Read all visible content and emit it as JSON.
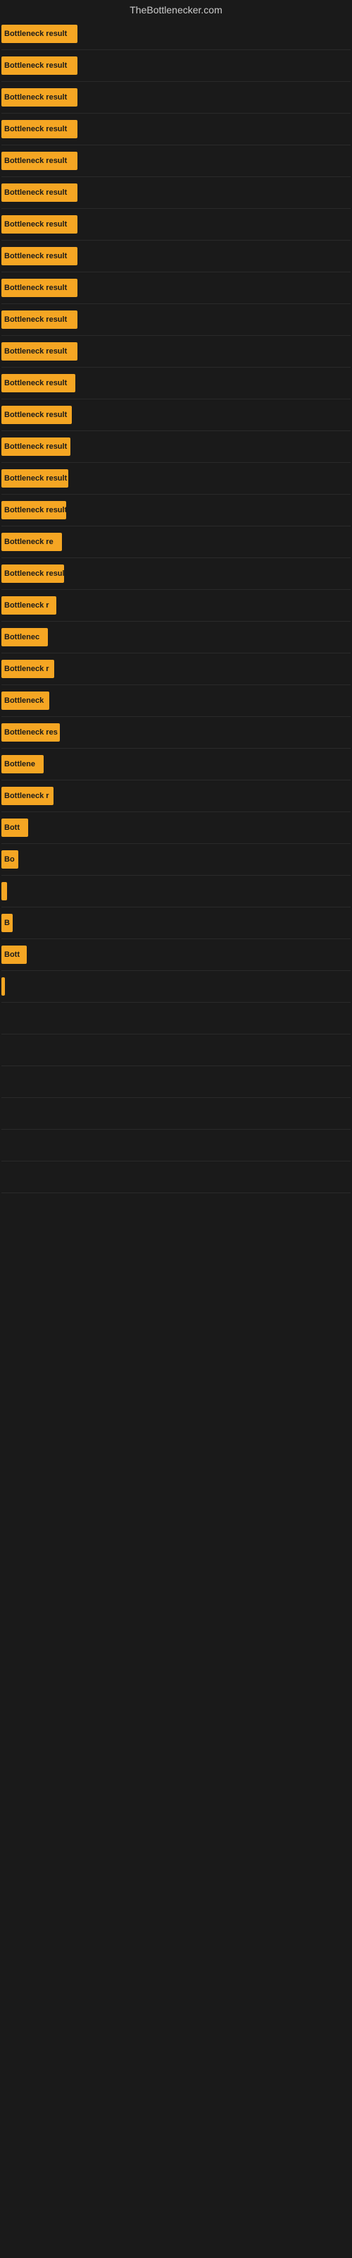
{
  "site": {
    "title": "TheBottlenecker.com"
  },
  "bars": [
    {
      "label": "Bottleneck result",
      "width": 108
    },
    {
      "label": "Bottleneck result",
      "width": 108
    },
    {
      "label": "Bottleneck result",
      "width": 108
    },
    {
      "label": "Bottleneck result",
      "width": 108
    },
    {
      "label": "Bottleneck result",
      "width": 108
    },
    {
      "label": "Bottleneck result",
      "width": 108
    },
    {
      "label": "Bottleneck result",
      "width": 108
    },
    {
      "label": "Bottleneck result",
      "width": 108
    },
    {
      "label": "Bottleneck result",
      "width": 108
    },
    {
      "label": "Bottleneck result",
      "width": 108
    },
    {
      "label": "Bottleneck result",
      "width": 108
    },
    {
      "label": "Bottleneck result",
      "width": 105
    },
    {
      "label": "Bottleneck result",
      "width": 100
    },
    {
      "label": "Bottleneck result",
      "width": 98
    },
    {
      "label": "Bottleneck result",
      "width": 95
    },
    {
      "label": "Bottleneck result",
      "width": 92
    },
    {
      "label": "Bottleneck re",
      "width": 86
    },
    {
      "label": "Bottleneck result",
      "width": 89
    },
    {
      "label": "Bottleneck r",
      "width": 78
    },
    {
      "label": "Bottlenec",
      "width": 66
    },
    {
      "label": "Bottleneck r",
      "width": 75
    },
    {
      "label": "Bottleneck",
      "width": 68
    },
    {
      "label": "Bottleneck res",
      "width": 83
    },
    {
      "label": "Bottlene",
      "width": 60
    },
    {
      "label": "Bottleneck r",
      "width": 74
    },
    {
      "label": "Bott",
      "width": 38
    },
    {
      "label": "Bo",
      "width": 24
    },
    {
      "label": "",
      "width": 8
    },
    {
      "label": "B",
      "width": 16
    },
    {
      "label": "Bott",
      "width": 36
    },
    {
      "label": "",
      "width": 5
    },
    {
      "label": "",
      "width": 0
    },
    {
      "label": "",
      "width": 0
    },
    {
      "label": "",
      "width": 0
    },
    {
      "label": "",
      "width": 0
    },
    {
      "label": "",
      "width": 0
    },
    {
      "label": "",
      "width": 0
    },
    {
      "label": "",
      "width": 0
    }
  ]
}
